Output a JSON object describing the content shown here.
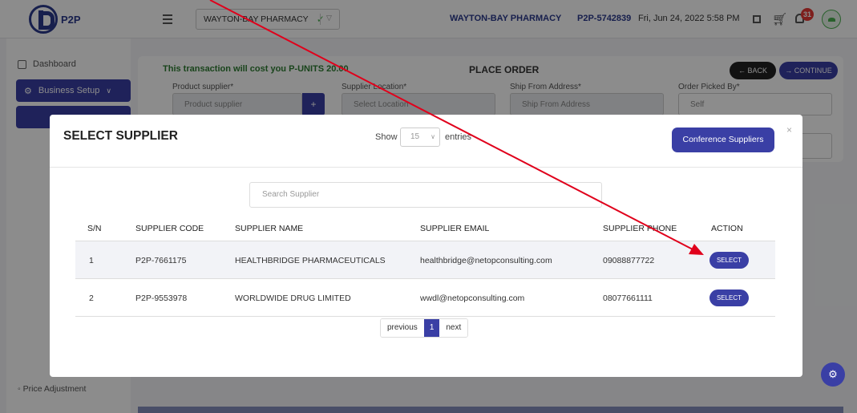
{
  "topbar": {
    "brand": "P2P",
    "pharmacy_select": "WAYTON-BAY PHARMACY",
    "pharmacy_name": "WAYTON-BAY PHARMACY",
    "user_code": "P2P-5742839",
    "datetime": "Fri, Jun 24, 2022 5:58 PM",
    "notification_count": "31",
    "icons": [
      "menu-icon",
      "book-icon",
      "cart-icon",
      "bell-icon",
      "avatar-icon"
    ]
  },
  "sidebar": {
    "dashboard": "Dashboard",
    "business_setup": "Business Setup",
    "price_adjustment": "Price Adjustment"
  },
  "place_order": {
    "cost_notice": "This transaction will cost you P-UNITS 20.00",
    "title": "PLACE ORDER",
    "back_label": "BACK",
    "continue_label": "CONTINUE",
    "fields": {
      "product_supplier_label": "Product supplier*",
      "product_supplier_placeholder": "Product supplier",
      "supplier_location_label": "Supplier Location*",
      "supplier_location_placeholder": "Select Location",
      "ship_from_label": "Ship From Address*",
      "ship_from_placeholder": "Ship From Address",
      "picked_by_label": "Order Picked By*",
      "picked_by_value": "Self"
    }
  },
  "modal": {
    "title": "SELECT SUPPLIER",
    "show_label": "Show",
    "entries_value": "15",
    "entries_label": "entries",
    "conference_button": "Conference Suppliers",
    "close": "×",
    "search_placeholder": "Search Supplier",
    "columns": [
      "S/N",
      "SUPPLIER CODE",
      "SUPPLIER NAME",
      "SUPPLIER EMAIL",
      "SUPPLIER PHONE",
      "ACTION"
    ],
    "rows": [
      {
        "sn": "1",
        "code": "P2P-7661175",
        "name": "HEALTHBRIDGE PHARMACEUTICALS",
        "email": "healthbridge@netopconsulting.com",
        "phone": "09088877722",
        "action": "SELECT"
      },
      {
        "sn": "2",
        "code": "P2P-9553978",
        "name": "WORLDWIDE DRUG LIMITED",
        "email": "wwdl@netopconsulting.com",
        "phone": "08077661111",
        "action": "SELECT"
      }
    ],
    "pager": {
      "previous": "previous",
      "current": "1",
      "next": "next"
    }
  },
  "colors": {
    "primary": "#3a3fa5",
    "brand": "#2b3a8c",
    "success": "#2e7d32",
    "annotation_arrow": "#e0001b"
  }
}
